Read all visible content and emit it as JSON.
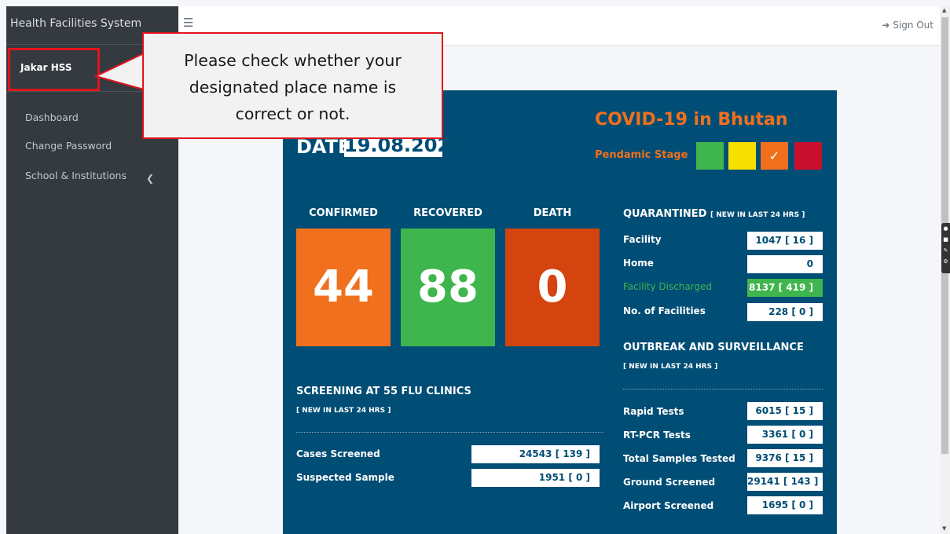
{
  "app": {
    "title": "Health Facilities System"
  },
  "user": {
    "name": "Jakar HSS"
  },
  "sidebar": {
    "items": [
      {
        "label": "Dashboard"
      },
      {
        "label": "Change Password"
      },
      {
        "label": "School & Institutions"
      }
    ]
  },
  "topbar": {
    "signout_label": "Sign Out"
  },
  "callout": {
    "lines": [
      "Please check whether your",
      "designated place name is",
      "correct or not."
    ]
  },
  "dashboard": {
    "date_label": "DATE",
    "date_value": "19.08.2020",
    "title": "COVID-19 in Bhutan",
    "stage_label": "Pendamic Stage",
    "stage_colors": [
      "#3fb54d",
      "#f7e000",
      "#f0701d",
      "#c8102e"
    ],
    "stage_active_index": 2,
    "metrics": [
      {
        "label": "CONFIRMED",
        "value": "44",
        "color": "#f0701d"
      },
      {
        "label": "RECOVERED",
        "value": "88",
        "color": "#3fb54d"
      },
      {
        "label": "DEATH",
        "value": "0",
        "color": "#d3440e"
      }
    ],
    "quarantined": {
      "title": "QUARANTINED",
      "subtitle": "[ NEW IN LAST 24 HRS ]",
      "rows": [
        {
          "label": "Facility",
          "value": "1047 [ 16 ]"
        },
        {
          "label": "Home",
          "value": "0"
        },
        {
          "label": "Facility Discharged",
          "value": "8137 [ 419 ]"
        },
        {
          "label": "No. of Facilities",
          "value": "228 [ 0 ]"
        }
      ]
    },
    "outbreak": {
      "title": "OUTBREAK AND SURVEILLANCE",
      "subtitle": "[ NEW IN LAST 24 HRS ]",
      "rows": [
        {
          "label": "Rapid Tests",
          "value": "6015 [ 15 ]"
        },
        {
          "label": "RT-PCR Tests",
          "value": "3361 [ 0 ]"
        },
        {
          "label": "Total Samples Tested",
          "value": "9376 [ 15 ]"
        },
        {
          "label": "Ground Screened",
          "value": "29141 [ 143 ]"
        },
        {
          "label": "Airport Screened",
          "value": "1695 [ 0 ]"
        }
      ]
    },
    "screening": {
      "title": "SCREENING AT 55 FLU CLINICS",
      "subtitle": "[ NEW IN LAST 24 HRS ]",
      "rows": [
        {
          "label": "Cases Screened",
          "value": "24543 [ 139 ]"
        },
        {
          "label": "Suspected Sample",
          "value": "1951 [ 0 ]"
        }
      ]
    }
  }
}
